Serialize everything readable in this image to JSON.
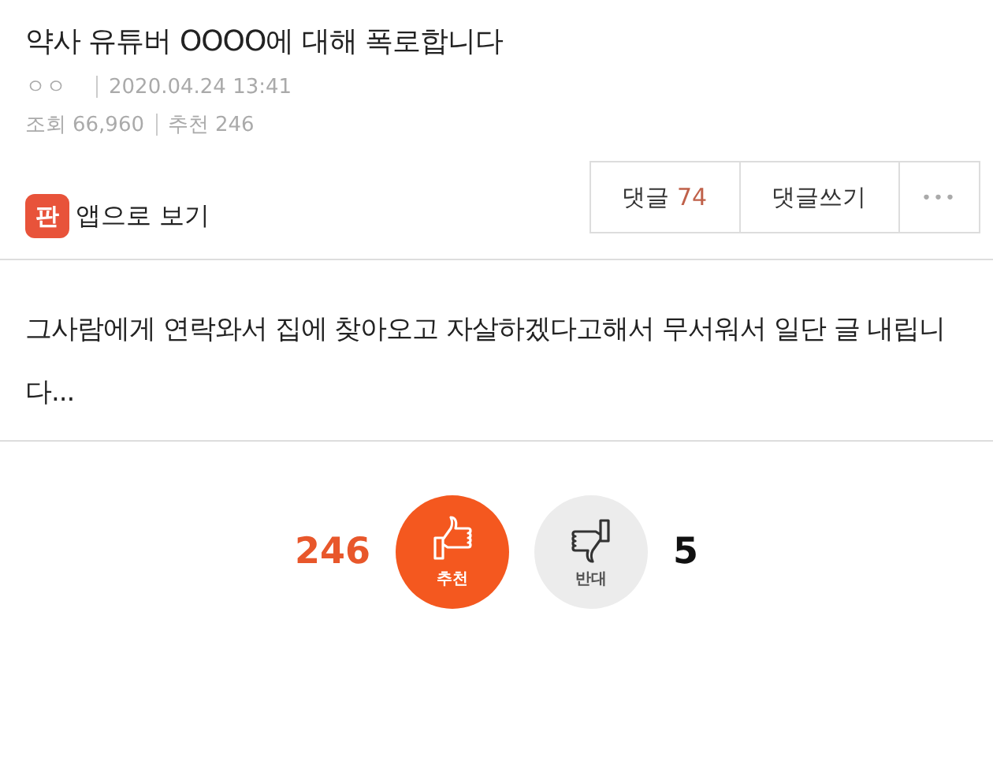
{
  "post": {
    "title": "약사 유튜버 OOOO에 대해 폭로합니다",
    "author": "ㅇㅇ",
    "date": "2020.04.24 13:41",
    "views_label": "조회",
    "views": "66,960",
    "recommend_label": "추천",
    "recommend": "246"
  },
  "app_link": {
    "icon_text": "판",
    "label": "앱으로 보기"
  },
  "actions": {
    "comments_label": "댓글",
    "comments_count": "74",
    "write_label": "댓글쓰기",
    "more": "•••"
  },
  "body": "그사람에게 연락와서 집에 찾아오고 자살하겠다고해서 무서워서 일단 글 내립니다...",
  "votes": [
    {
      "kind": "up",
      "count": "246",
      "label": "추천"
    },
    {
      "kind": "down",
      "count": "5",
      "label": "반대"
    }
  ]
}
